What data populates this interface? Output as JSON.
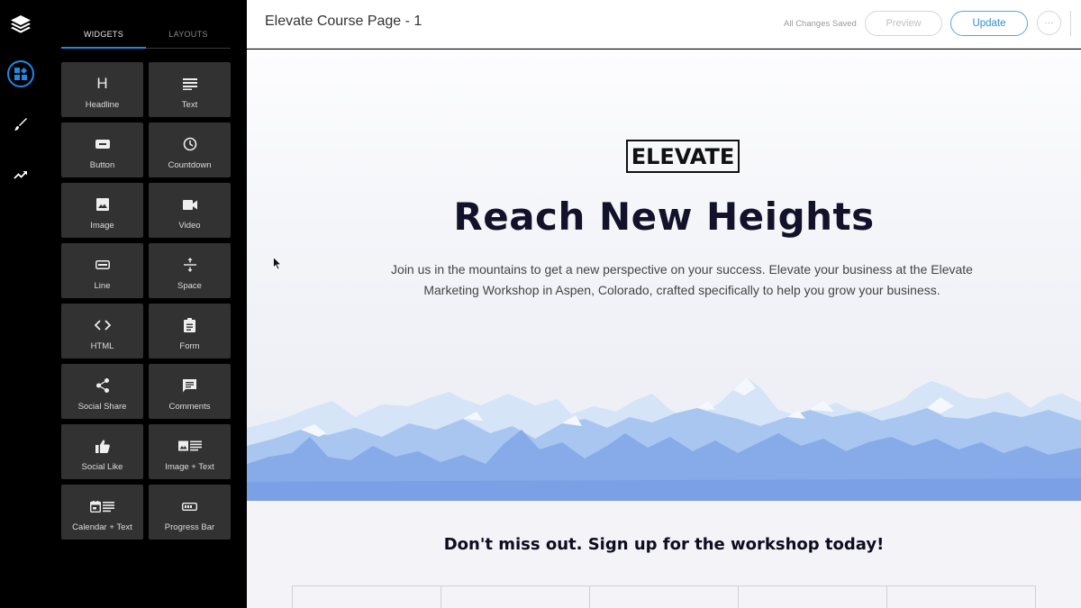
{
  "rail": {
    "items": [
      {
        "name": "layers-logo-icon"
      },
      {
        "name": "widgets-icon",
        "active": true
      },
      {
        "name": "paintbrush-icon"
      },
      {
        "name": "trending-up-icon"
      }
    ]
  },
  "panel": {
    "tabs": [
      {
        "label": "WIDGETS",
        "active": true
      },
      {
        "label": "LAYOUTS",
        "active": false
      }
    ],
    "widgets": [
      {
        "label": "Headline",
        "icon": "headline-icon"
      },
      {
        "label": "Text",
        "icon": "text-icon"
      },
      {
        "label": "Button",
        "icon": "button-icon"
      },
      {
        "label": "Countdown",
        "icon": "clock-icon"
      },
      {
        "label": "Image",
        "icon": "image-icon"
      },
      {
        "label": "Video",
        "icon": "video-icon"
      },
      {
        "label": "Line",
        "icon": "line-icon"
      },
      {
        "label": "Space",
        "icon": "space-icon"
      },
      {
        "label": "HTML",
        "icon": "code-icon"
      },
      {
        "label": "Form",
        "icon": "clipboard-icon"
      },
      {
        "label": "Social Share",
        "icon": "share-icon"
      },
      {
        "label": "Comments",
        "icon": "comment-icon"
      },
      {
        "label": "Social Like",
        "icon": "thumbs-up-icon"
      },
      {
        "label": "Image + Text",
        "icon": "image-text-icon"
      },
      {
        "label": "Calendar + Text",
        "icon": "calendar-text-icon"
      },
      {
        "label": "Progress Bar",
        "icon": "progress-bar-icon"
      }
    ]
  },
  "topbar": {
    "title": "Elevate Course Page - 1",
    "status": "All Changes Saved",
    "preview_label": "Preview",
    "update_label": "Update",
    "more_label": "···"
  },
  "page": {
    "brand": "ELEVATE",
    "headline": "Reach New Heights",
    "subtext": "Join us in the mountains to get a new perspective on your success. Elevate your business at the Elevate Marketing Workshop in Aspen, Colorado, crafted specifically to help you grow your business.",
    "cta": "Don't miss out. Sign up for the workshop today!",
    "columns": 5
  },
  "colors": {
    "accent": "#1e88e5",
    "tile": "#323232",
    "headline": "#12122a",
    "mountain_light": "#cfe0f7",
    "mountain_mid": "#8fb4ec",
    "mountain_dark": "#6f98e2"
  }
}
